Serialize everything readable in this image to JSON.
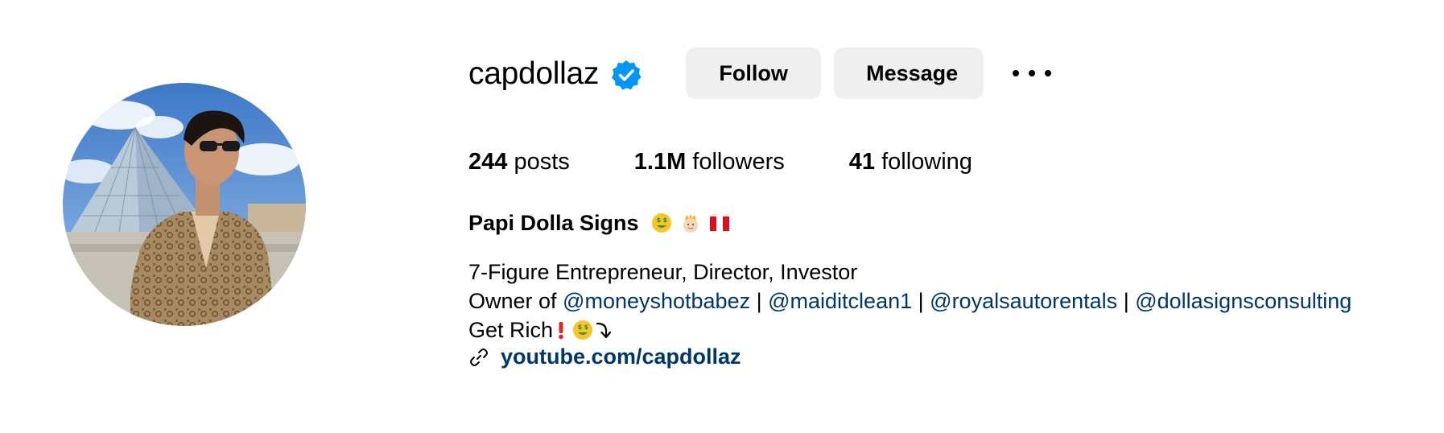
{
  "profile": {
    "username": "capdollaz",
    "verified": true,
    "avatar_alt": "profile-photo",
    "actions": {
      "follow_label": "Follow",
      "message_label": "Message"
    },
    "stats": {
      "posts_count": "244",
      "posts_label": " posts",
      "followers_count": "1.1M",
      "followers_label": " followers",
      "following_count": "41",
      "following_label": " following"
    },
    "full_name": "Papi Dolla Signs",
    "bio": {
      "line1": "7-Figure Entrepreneur, Director, Investor",
      "owner_prefix": "Owner of ",
      "mentions": [
        "@moneyshotbabez",
        "@maiditclean1",
        "@royalsautorentals",
        "@dollasignsconsulting"
      ],
      "separator": " | ",
      "line3_text": "Get Rich"
    },
    "link_text": "youtube.com/capdollaz"
  },
  "colors": {
    "accent_link": "#00376b",
    "verified_blue": "#0095f6",
    "button_bg": "#efefef"
  },
  "icons": [
    "verified-badge-icon",
    "more-options-icon",
    "link-icon",
    "money-mouth-emoji-icon",
    "prince-emoji-icon",
    "peru-flag-icon",
    "exclamation-icon",
    "arrow-down-icon"
  ]
}
